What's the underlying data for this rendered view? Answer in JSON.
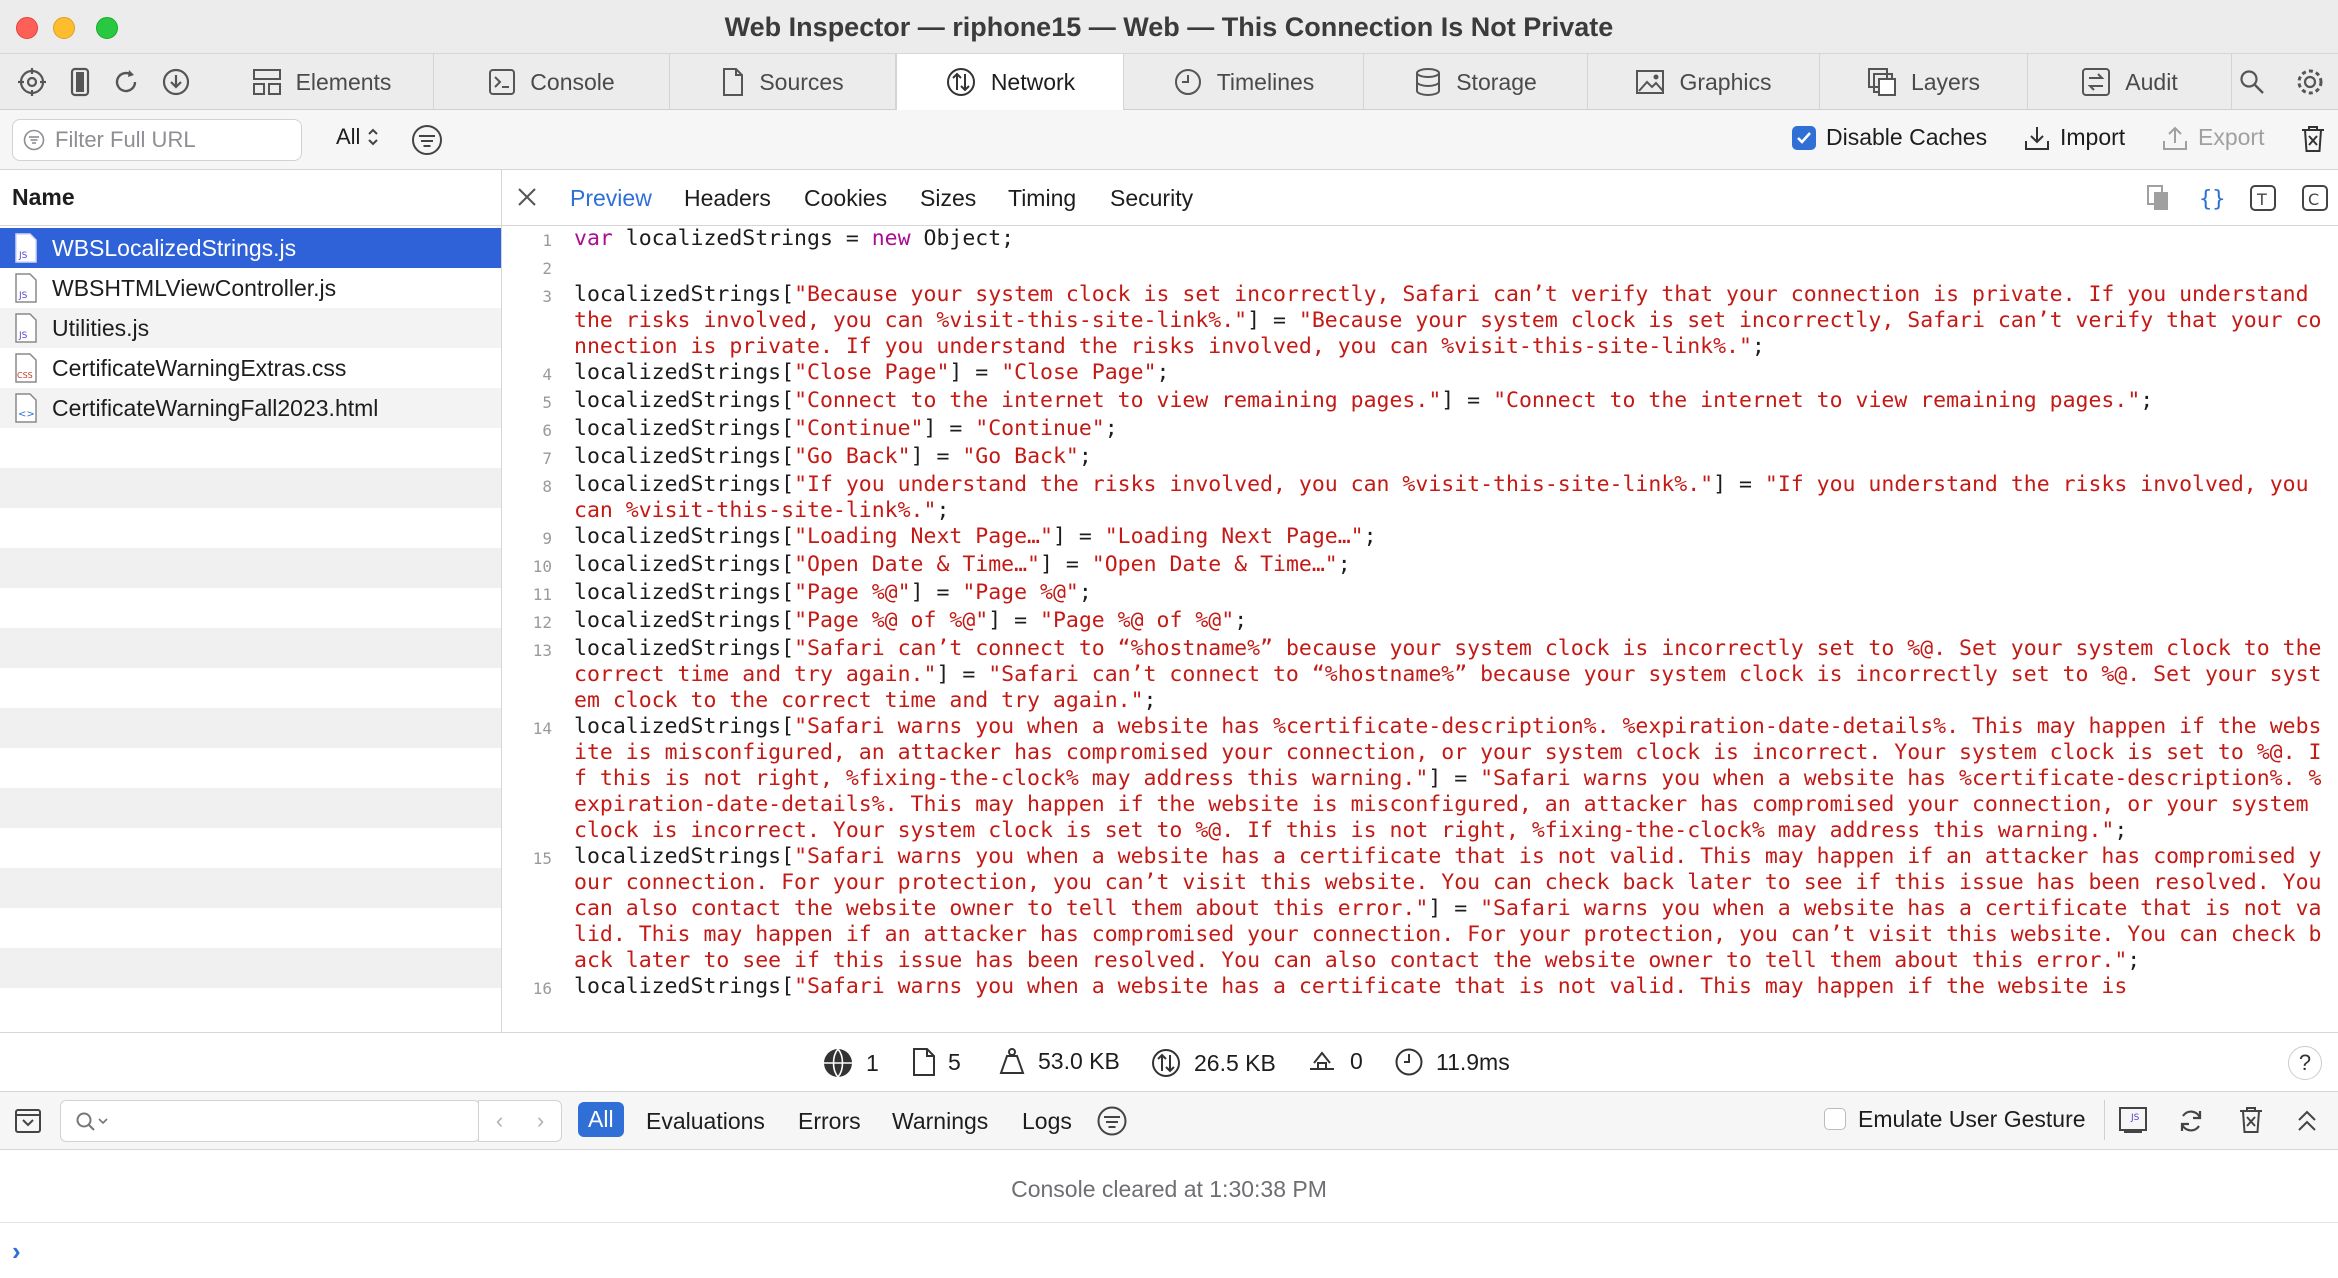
{
  "window": {
    "title": "Web Inspector — riphone15 — Web — This Connection Is Not Private"
  },
  "tabs": [
    {
      "label": "Elements",
      "icon": "elements-icon"
    },
    {
      "label": "Console",
      "icon": "console-icon"
    },
    {
      "label": "Sources",
      "icon": "sources-icon"
    },
    {
      "label": "Network",
      "icon": "network-icon"
    },
    {
      "label": "Timelines",
      "icon": "timelines-icon"
    },
    {
      "label": "Storage",
      "icon": "storage-icon"
    },
    {
      "label": "Graphics",
      "icon": "graphics-icon"
    },
    {
      "label": "Layers",
      "icon": "layers-icon"
    },
    {
      "label": "Audit",
      "icon": "audit-icon"
    }
  ],
  "active_tab": "Network",
  "filterbar": {
    "placeholder": "Filter Full URL",
    "type_filter": "All",
    "disable_caches_label": "Disable Caches",
    "disable_caches_checked": true,
    "import_label": "Import",
    "export_label": "Export"
  },
  "sidebar": {
    "header": "Name",
    "files": [
      {
        "name": "WBSLocalizedStrings.js",
        "type": "JS",
        "selected": true
      },
      {
        "name": "WBSHTMLViewController.js",
        "type": "JS",
        "selected": false
      },
      {
        "name": "Utilities.js",
        "type": "JS",
        "selected": false
      },
      {
        "name": "CertificateWarningExtras.css",
        "type": "CSS",
        "selected": false
      },
      {
        "name": "CertificateWarningFall2023.html",
        "type": "<>",
        "selected": false
      }
    ]
  },
  "preview_tabs": [
    "Preview",
    "Headers",
    "Cookies",
    "Sizes",
    "Timing",
    "Security"
  ],
  "active_preview_tab": "Preview",
  "code_lines": [
    {
      "n": "1",
      "pre": "var localizedStrings = new Object;",
      "key": "",
      "mid": "",
      "val": "",
      "end": ""
    },
    {
      "n": "2",
      "pre": "",
      "key": "",
      "mid": "",
      "val": "",
      "end": ""
    },
    {
      "n": "3",
      "pre": "localizedStrings[",
      "key": "\"Because your system clock is set incorrectly, Safari can’t verify that your connection is private. If you understand the risks involved, you can %visit-this-site-link%.\"",
      "mid": "] = ",
      "val": "\"Because your system clock is set incorrectly, Safari can’t verify that your connection is private. If you understand the risks involved, you can %visit-this-site-link%.\"",
      "end": ";"
    },
    {
      "n": "4",
      "pre": "localizedStrings[",
      "key": "\"Close Page\"",
      "mid": "] = ",
      "val": "\"Close Page\"",
      "end": ";"
    },
    {
      "n": "5",
      "pre": "localizedStrings[",
      "key": "\"Connect to the internet to view remaining pages.\"",
      "mid": "] = ",
      "val": "\"Connect to the internet to view remaining pages.\"",
      "end": ";"
    },
    {
      "n": "6",
      "pre": "localizedStrings[",
      "key": "\"Continue\"",
      "mid": "] = ",
      "val": "\"Continue\"",
      "end": ";"
    },
    {
      "n": "7",
      "pre": "localizedStrings[",
      "key": "\"Go Back\"",
      "mid": "] = ",
      "val": "\"Go Back\"",
      "end": ";"
    },
    {
      "n": "8",
      "pre": "localizedStrings[",
      "key": "\"If you understand the risks involved, you can %visit-this-site-link%.\"",
      "mid": "] = ",
      "val": "\"If you understand the risks involved, you can %visit-this-site-link%.\"",
      "end": ";"
    },
    {
      "n": "9",
      "pre": "localizedStrings[",
      "key": "\"Loading Next Page…\"",
      "mid": "] = ",
      "val": "\"Loading Next Page…\"",
      "end": ";"
    },
    {
      "n": "10",
      "pre": "localizedStrings[",
      "key": "\"Open Date & Time…\"",
      "mid": "] = ",
      "val": "\"Open Date & Time…\"",
      "end": ";"
    },
    {
      "n": "11",
      "pre": "localizedStrings[",
      "key": "\"Page %@\"",
      "mid": "] = ",
      "val": "\"Page %@\"",
      "end": ";"
    },
    {
      "n": "12",
      "pre": "localizedStrings[",
      "key": "\"Page %@ of %@\"",
      "mid": "] = ",
      "val": "\"Page %@ of %@\"",
      "end": ";"
    },
    {
      "n": "13",
      "pre": "localizedStrings[",
      "key": "\"Safari can’t connect to “%hostname%” because your system clock is incorrectly set to %@. Set your system clock to the correct time and try again.\"",
      "mid": "] = ",
      "val": "\"Safari can’t connect to “%hostname%” because your system clock is incorrectly set to %@. Set your system clock to the correct time and try again.\"",
      "end": ";"
    },
    {
      "n": "14",
      "pre": "localizedStrings[",
      "key": "\"Safari warns you when a website has %certificate-description%. %expiration-date-details%. This may happen if the website is misconfigured, an attacker has compromised your connection, or your system clock is incorrect. Your system clock is set to %@. If this is not right, %fixing-the-clock% may address this warning.\"",
      "mid": "] = ",
      "val": "\"Safari warns you when a website has %certificate-description%. %expiration-date-details%. This may happen if the website is misconfigured, an attacker has compromised your connection, or your system clock is incorrect. Your system clock is set to %@. If this is not right, %fixing-the-clock% may address this warning.\"",
      "end": ";"
    },
    {
      "n": "15",
      "pre": "localizedStrings[",
      "key": "\"Safari warns you when a website has a certificate that is not valid. This may happen if an attacker has compromised your connection. For your protection, you can’t visit this website. You can check back later to see if this issue has been resolved. You can also contact the website owner to tell them about this error.\"",
      "mid": "] = ",
      "val": "\"Safari warns you when a website has a certificate that is not valid. This may happen if an attacker has compromised your connection. For your protection, you can’t visit this website. You can check back later to see if this issue has been resolved. You can also contact the website owner to tell them about this error.\"",
      "end": ";"
    },
    {
      "n": "16",
      "pre": "localizedStrings[",
      "key": "\"Safari warns you when a website has a certificate that is not valid. This may happen if the website is",
      "mid": "",
      "val": "",
      "end": ""
    }
  ],
  "status": {
    "domains": "1",
    "resources": "5",
    "size": "53.0 KB",
    "transferred": "26.5 KB",
    "redirects": "0",
    "time": "11.9ms",
    "help": "?"
  },
  "console": {
    "filters": [
      "All",
      "Evaluations",
      "Errors",
      "Warnings",
      "Logs"
    ],
    "active_filter": "All",
    "emulate_label": "Emulate User Gesture",
    "message": "Console cleared at 1:30:38 PM",
    "prompt": "›"
  },
  "colors": {
    "accent": "#2f6fd6",
    "selection": "#2f62d8",
    "string": "#c41a16",
    "keyword": "#aa0d91"
  }
}
